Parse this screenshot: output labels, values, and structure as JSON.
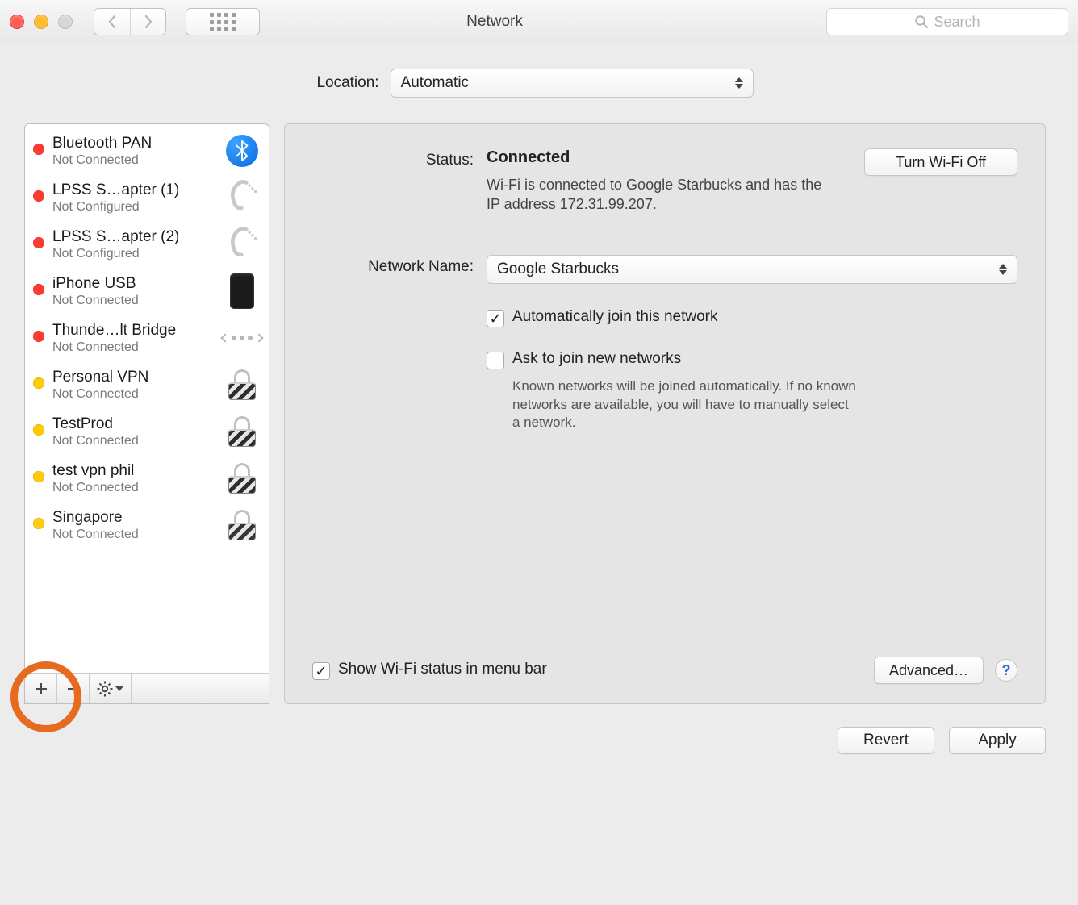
{
  "window": {
    "title": "Network",
    "search_placeholder": "Search"
  },
  "location": {
    "label": "Location:",
    "value": "Automatic"
  },
  "services": [
    {
      "name": "Bluetooth PAN",
      "status": "Not Connected",
      "led": "red",
      "icon": "bluetooth"
    },
    {
      "name": "LPSS S…apter (1)",
      "status": "Not Configured",
      "led": "red",
      "icon": "serial"
    },
    {
      "name": "LPSS S…apter (2)",
      "status": "Not Configured",
      "led": "red",
      "icon": "serial"
    },
    {
      "name": "iPhone USB",
      "status": "Not Connected",
      "led": "red",
      "icon": "iphone"
    },
    {
      "name": "Thunde…lt Bridge",
      "status": "Not Connected",
      "led": "red",
      "icon": "thunderbolt"
    },
    {
      "name": "Personal VPN",
      "status": "Not Connected",
      "led": "yellow",
      "icon": "lock"
    },
    {
      "name": "TestProd",
      "status": "Not Connected",
      "led": "yellow",
      "icon": "lock"
    },
    {
      "name": "test vpn phil",
      "status": "Not Connected",
      "led": "yellow",
      "icon": "lock"
    },
    {
      "name": "Singapore",
      "status": "Not Connected",
      "led": "yellow",
      "icon": "lock"
    }
  ],
  "detail": {
    "status_label": "Status:",
    "status_value": "Connected",
    "status_desc": "Wi-Fi is connected to Google Starbucks and has the IP address 172.31.99.207.",
    "wifi_toggle": "Turn Wi-Fi Off",
    "network_name_label": "Network Name:",
    "network_name_value": "Google Starbucks",
    "auto_join_label": "Automatically join this network",
    "auto_join_checked": true,
    "ask_join_label": "Ask to join new networks",
    "ask_join_checked": false,
    "ask_join_hint": "Known networks will be joined automatically. If no known networks are available, you will have to manually select a network.",
    "show_menubar_label": "Show Wi-Fi status in menu bar",
    "show_menubar_checked": true,
    "advanced_button": "Advanced…"
  },
  "buttons": {
    "revert": "Revert",
    "apply": "Apply"
  }
}
